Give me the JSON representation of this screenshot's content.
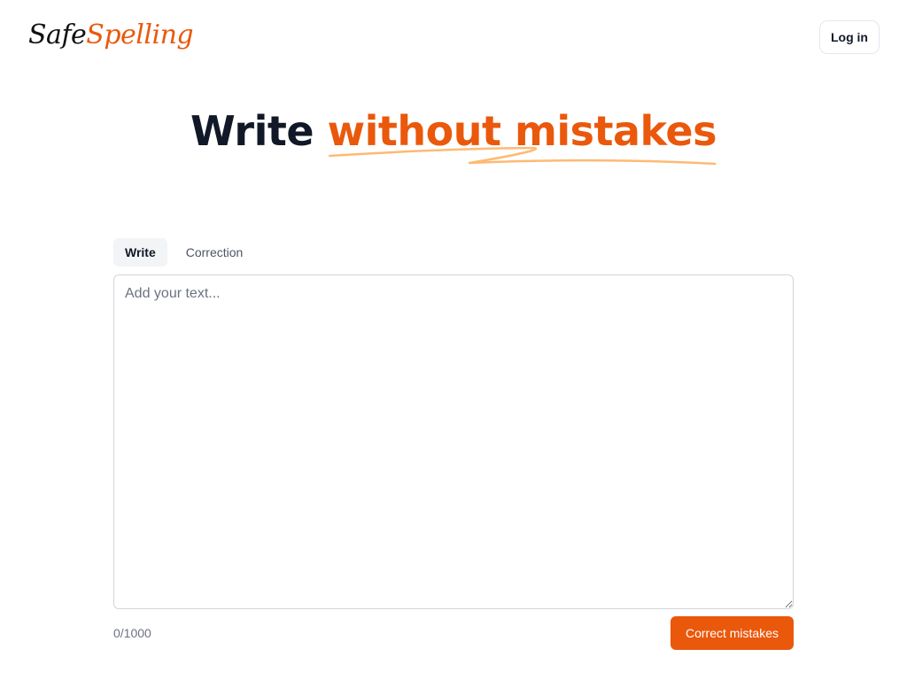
{
  "header": {
    "logo": {
      "part1": "Safe",
      "part2": "Spelling"
    },
    "login_label": "Log in"
  },
  "hero": {
    "title_plain": "Write ",
    "title_accent": "without mistakes"
  },
  "tabs": [
    {
      "label": "Write",
      "active": true
    },
    {
      "label": "Correction",
      "active": false
    }
  ],
  "editor": {
    "placeholder": "Add your text...",
    "value": ""
  },
  "footer": {
    "char_count": "0/1000",
    "correct_label": "Correct mistakes"
  },
  "colors": {
    "accent": "#ea580c",
    "underline": "#fdba74",
    "text": "#111827"
  }
}
